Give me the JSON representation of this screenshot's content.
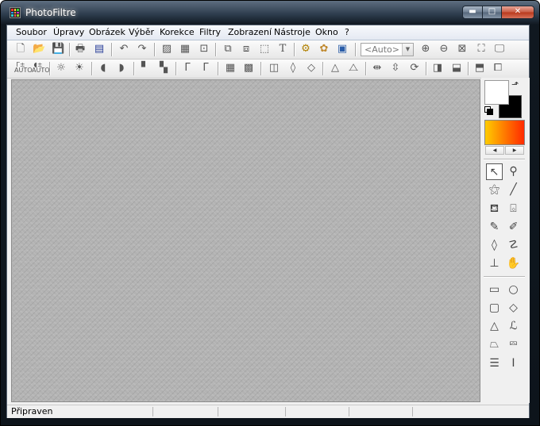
{
  "window": {
    "title": "PhotoFiltre"
  },
  "titlebar_buttons": {
    "minimize": "▬",
    "maximize": "□",
    "close": "✕"
  },
  "menu": [
    "Soubor",
    "Úpravy",
    "Obrázek",
    "Výběr",
    "Korekce",
    "Filtry",
    "Zobrazení",
    "Nástroje",
    "Okno",
    "?"
  ],
  "toolbar1": {
    "icons": [
      "new-icon",
      "open-icon",
      "save-icon",
      "print-icon",
      "scanner-icon",
      "undo-icon",
      "redo-icon",
      "image-size-icon",
      "canvas-size-icon",
      "crop-icon",
      "copy-icon",
      "paste-icon",
      "selection-icon",
      "text-icon",
      "automate-icon",
      "plugin-icon",
      "browser-icon",
      "zoom-in-icon",
      "zoom-out-icon",
      "actual-size-icon",
      "fit-window-icon",
      "fullscreen-icon"
    ],
    "zoom_value": "<Auto>"
  },
  "toolbar2": {
    "labels": {
      "auto_levels": "Γ±",
      "auto_contrast": "◖±",
      "auto_caption": "AUTO"
    }
  },
  "status": {
    "text": "Připraven"
  },
  "colors": {
    "foreground": "#ffffff",
    "background": "#000000",
    "gradient_start": "#ffcc00",
    "gradient_end": "#ff2a00",
    "workspace": "#b2b2b2"
  }
}
